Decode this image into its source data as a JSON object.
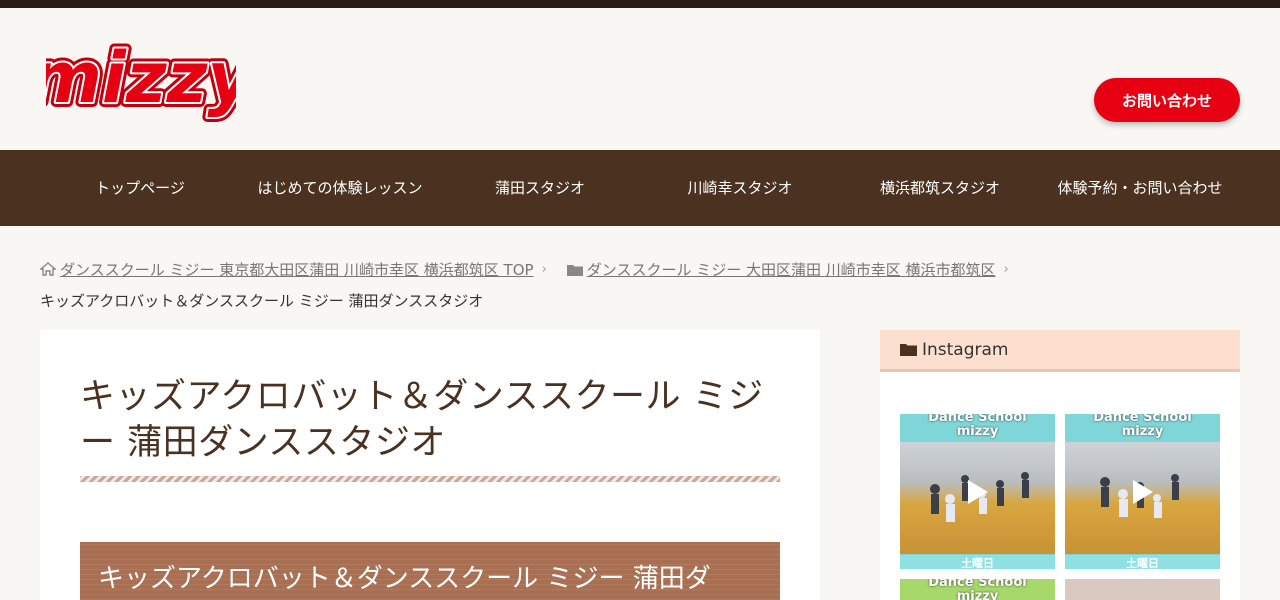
{
  "logo": {
    "text": "mizzy"
  },
  "header": {
    "contact_label": "お問い合わせ"
  },
  "nav": {
    "items": [
      {
        "label": "トップページ"
      },
      {
        "label": "はじめての体験レッスン"
      },
      {
        "label": "蒲田スタジオ"
      },
      {
        "label": "川崎幸スタジオ"
      },
      {
        "label": "横浜都筑スタジオ"
      },
      {
        "label": "体験予約・お問い合わせ"
      }
    ]
  },
  "breadcrumb": {
    "home": "ダンススクール ミジー 東京都大田区蒲田 川崎市幸区 横浜都筑区 TOP",
    "category": "ダンススクール ミジー 大田区蒲田 川崎市幸区 横浜市都筑区",
    "current": "キッズアクロバット＆ダンススクール ミジー 蒲田ダンススタジオ"
  },
  "main": {
    "title": "キッズアクロバット＆ダンススクール ミジー 蒲田ダンススタジオ",
    "subheading": "キッズアクロバット＆ダンススクール ミジー 蒲田ダ"
  },
  "sidebar": {
    "widget_title": "Instagram",
    "posts": [
      {
        "caption1": "Dance School",
        "caption2": "mizzy",
        "bottom": "土曜日"
      },
      {
        "caption1": "Dance School",
        "caption2": "mizzy",
        "bottom": "土曜日"
      },
      {
        "caption1": "Dance School",
        "caption2": "mizzy"
      }
    ]
  },
  "colors": {
    "topbar": "#2b1d12",
    "nav_bg": "#4b3120",
    "accent_red": "#e60012",
    "subhead_bg": "#a86f52",
    "widget_head": "#fddfd0"
  },
  "icons": [
    "home-icon",
    "folder-icon",
    "chevron-right-icon",
    "play-icon"
  ]
}
